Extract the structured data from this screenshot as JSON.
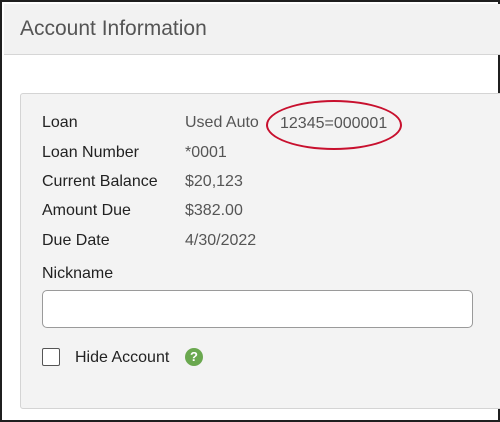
{
  "header": {
    "title": "Account Information"
  },
  "details": {
    "loan_label": "Loan",
    "loan_type": "Used Auto",
    "loan_id": "12345=000001",
    "loan_number_label": "Loan Number",
    "loan_number_value": "*0001",
    "current_balance_label": "Current Balance",
    "current_balance_value": "$20,123",
    "amount_due_label": "Amount Due",
    "amount_due_value": "$382.00",
    "due_date_label": "Due Date",
    "due_date_value": "4/30/2022"
  },
  "nickname": {
    "label": "Nickname",
    "value": "",
    "placeholder": ""
  },
  "hide_account": {
    "label": "Hide Account",
    "checked": false,
    "help_icon": "?"
  },
  "colors": {
    "annotation_circle": "#c8102e",
    "help_icon": "#6aa84f",
    "header_bg": "#f2f2f2",
    "panel_bg": "#f3f3f3"
  }
}
